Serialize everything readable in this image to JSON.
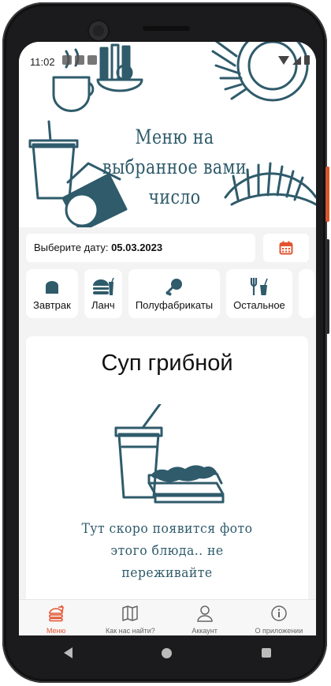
{
  "status_bar": {
    "time": "11:02"
  },
  "header": {
    "title": "Меню на выбранное вами число"
  },
  "date_picker": {
    "label": "Выберите дату:",
    "value": "05.03.2023",
    "icon": "calendar-icon"
  },
  "categories": [
    {
      "label": "Завтрак",
      "icon": "bread-icon"
    },
    {
      "label": "Ланч",
      "icon": "burger-drink-icon"
    },
    {
      "label": "Полуфабрикаты",
      "icon": "drumstick-icon"
    },
    {
      "label": "Остальное",
      "icon": "utensils-drink-icon"
    }
  ],
  "dish": {
    "title": "Суп грибной",
    "placeholder_text": "Тут скоро появится фото этого блюда.. не переживайте"
  },
  "bottom_nav": [
    {
      "label": "Меню",
      "icon": "food-menu-icon",
      "active": true
    },
    {
      "label": "Как нас найти?",
      "icon": "map-icon",
      "active": false
    },
    {
      "label": "Аккаунт",
      "icon": "user-icon",
      "active": false
    },
    {
      "label": "О приложении",
      "icon": "info-icon",
      "active": false
    }
  ],
  "colors": {
    "accent": "#e4532f",
    "illustration": "#2f5b6b",
    "background": "#f3f3f3"
  }
}
